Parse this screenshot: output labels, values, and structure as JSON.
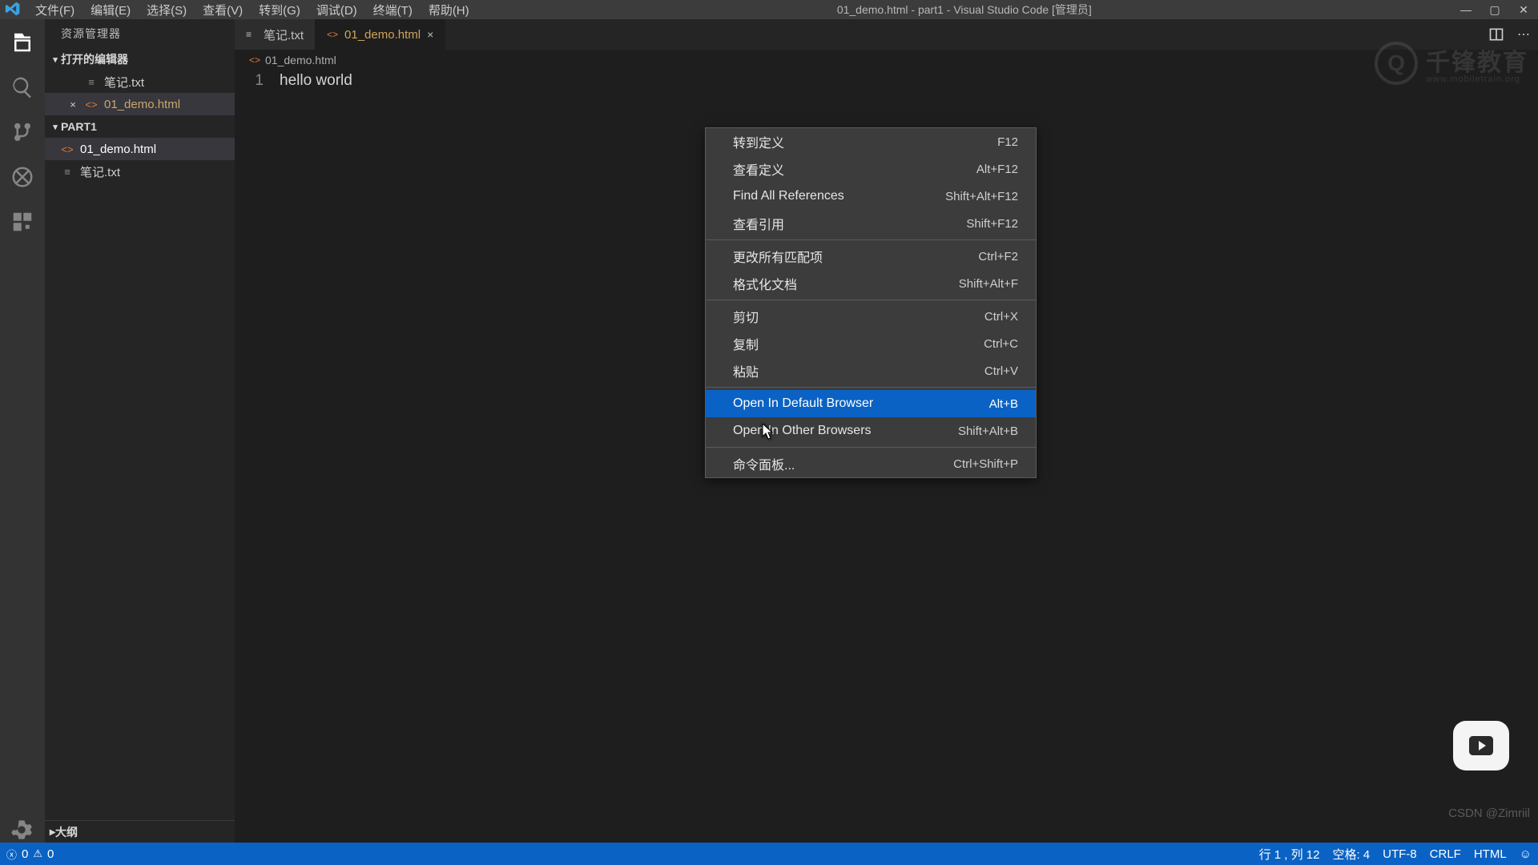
{
  "title": "01_demo.html - part1 - Visual Studio Code [管理员]",
  "menu": [
    "文件(F)",
    "编辑(E)",
    "选择(S)",
    "查看(V)",
    "转到(G)",
    "调试(D)",
    "终端(T)",
    "帮助(H)"
  ],
  "sidebar": {
    "title": "资源管理器",
    "open_editors_label": "打开的编辑器",
    "open_editors": [
      {
        "name": "笔记.txt",
        "kind": "txt",
        "close": "",
        "modified": false
      },
      {
        "name": "01_demo.html",
        "kind": "html",
        "close": "×",
        "modified": true
      }
    ],
    "project_label": "PART1",
    "files": [
      {
        "name": "01_demo.html",
        "kind": "html",
        "active": true
      },
      {
        "name": "笔记.txt",
        "kind": "txt",
        "active": false
      }
    ],
    "outline_label": "大纲"
  },
  "tabs": [
    {
      "name": "笔记.txt",
      "kind": "txt",
      "active": false,
      "modified": false
    },
    {
      "name": "01_demo.html",
      "kind": "html",
      "active": true,
      "modified": true
    }
  ],
  "breadcrumb": {
    "name": "01_demo.html"
  },
  "editor": {
    "line_number": "1",
    "content": "hello world"
  },
  "context_menu": [
    {
      "type": "item",
      "label": "转到定义",
      "shortcut": "F12"
    },
    {
      "type": "item",
      "label": "查看定义",
      "shortcut": "Alt+F12"
    },
    {
      "type": "item",
      "label": "Find All References",
      "shortcut": "Shift+Alt+F12"
    },
    {
      "type": "item",
      "label": "查看引用",
      "shortcut": "Shift+F12"
    },
    {
      "type": "sep"
    },
    {
      "type": "item",
      "label": "更改所有匹配项",
      "shortcut": "Ctrl+F2"
    },
    {
      "type": "item",
      "label": "格式化文档",
      "shortcut": "Shift+Alt+F"
    },
    {
      "type": "sep"
    },
    {
      "type": "item",
      "label": "剪切",
      "shortcut": "Ctrl+X"
    },
    {
      "type": "item",
      "label": "复制",
      "shortcut": "Ctrl+C"
    },
    {
      "type": "item",
      "label": "粘贴",
      "shortcut": "Ctrl+V"
    },
    {
      "type": "sep"
    },
    {
      "type": "item",
      "label": "Open In Default Browser",
      "shortcut": "Alt+B",
      "highlight": true
    },
    {
      "type": "item",
      "label": "Open In Other Browsers",
      "shortcut": "Shift+Alt+B"
    },
    {
      "type": "sep"
    },
    {
      "type": "item",
      "label": "命令面板...",
      "shortcut": "Ctrl+Shift+P"
    }
  ],
  "status": {
    "errors": "0",
    "warnings": "0",
    "cursor": "行 1 , 列 12",
    "spaces": "空格: 4",
    "encoding": "UTF-8",
    "eol": "CRLF",
    "language": "HTML",
    "feedback_icon": "☺"
  },
  "watermark": {
    "brand": "千锋教育",
    "sub": "www.mobiletrain.org"
  },
  "csdn": "CSDN @Zimriil"
}
